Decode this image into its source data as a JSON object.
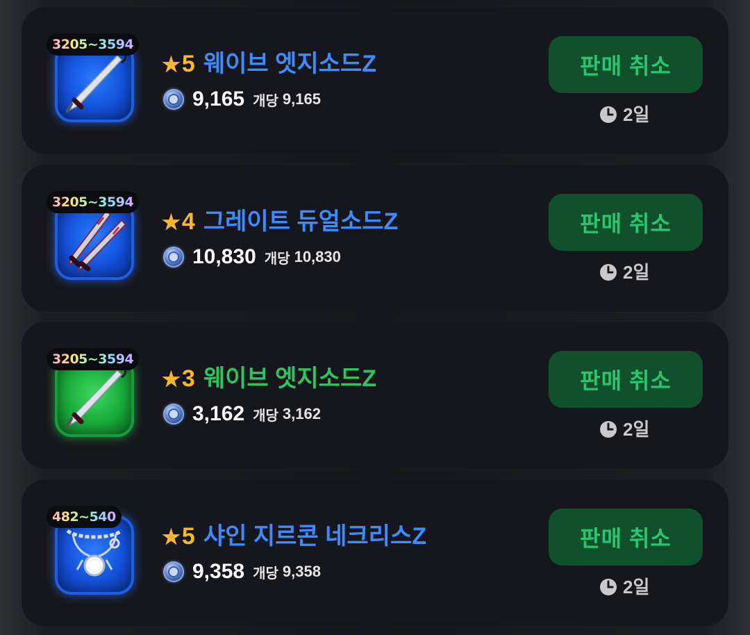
{
  "colors": {
    "card_background": "#16171c",
    "grade_star": "#f7b731",
    "cancel_button_bg": "#11502d",
    "cancel_button_text": "#29c66d",
    "blue_item_name": "#3d8bff",
    "green_item_name": "#2fc45e"
  },
  "listings": [
    {
      "power_range": "3205~3594",
      "grade_star": "★",
      "grade": "5",
      "name": "웨이브 엣지소드Z",
      "name_color": "#3d8bff",
      "rarity_color": "blue",
      "icon": "wave-edge-sword-icon",
      "currency_icon": "diamond-coin-icon",
      "total_price": "9,165",
      "unit_label": "개당",
      "unit_price": "9,165",
      "cancel_label": "판매 취소",
      "time_icon": "clock-icon",
      "time_remaining": "2일"
    },
    {
      "power_range": "3205~3594",
      "grade_star": "★",
      "grade": "4",
      "name": "그레이트 듀얼소드Z",
      "name_color": "#3d8bff",
      "rarity_color": "blue",
      "icon": "great-dual-sword-icon",
      "currency_icon": "diamond-coin-icon",
      "total_price": "10,830",
      "unit_label": "개당",
      "unit_price": "10,830",
      "cancel_label": "판매 취소",
      "time_icon": "clock-icon",
      "time_remaining": "2일"
    },
    {
      "power_range": "3205~3594",
      "grade_star": "★",
      "grade": "3",
      "name": "웨이브 엣지소드Z",
      "name_color": "#2fc45e",
      "rarity_color": "green",
      "icon": "wave-edge-sword-icon",
      "currency_icon": "diamond-coin-icon",
      "total_price": "3,162",
      "unit_label": "개당",
      "unit_price": "3,162",
      "cancel_label": "판매 취소",
      "time_icon": "clock-icon",
      "time_remaining": "2일"
    },
    {
      "power_range": "482~540",
      "grade_star": "★",
      "grade": "5",
      "name": "샤인 지르콘 네크리스Z",
      "name_color": "#3d8bff",
      "rarity_color": "blue",
      "icon": "shine-zircon-necklace-icon",
      "currency_icon": "diamond-coin-icon",
      "total_price": "9,358",
      "unit_label": "개당",
      "unit_price": "9,358",
      "cancel_label": "판매 취소",
      "time_icon": "clock-icon",
      "time_remaining": "2일"
    }
  ]
}
